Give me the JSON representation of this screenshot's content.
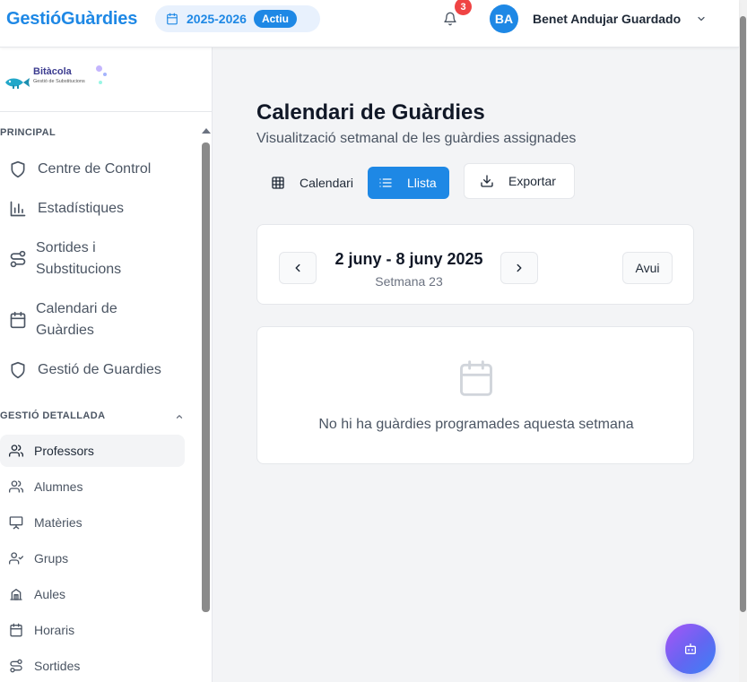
{
  "header": {
    "brand": "GestióGuàrdies",
    "year_label": "2025-2026",
    "year_badge": "Actiu",
    "notifications_count": "3",
    "user_initials": "BA",
    "user_name": "Benet Andujar Guardado"
  },
  "sidebar": {
    "logo_title": "Bitàcola",
    "logo_subtitle": "Gestió de Substitucions",
    "section_principal": "PRINCIPAL",
    "principal_items": [
      {
        "label_line1": "Centre de Control",
        "label_line2": "",
        "icon": "shield-icon"
      },
      {
        "label_line1": "Estadístiques",
        "label_line2": "",
        "icon": "bar-chart-icon"
      },
      {
        "label_line1": "Sortides i",
        "label_line2": "Substitucions",
        "icon": "route-icon"
      },
      {
        "label_line1": "Calendari de",
        "label_line2": "Guàrdies",
        "icon": "calendar-icon"
      },
      {
        "label_line1": "Gestió de Guardies",
        "label_line2": "",
        "icon": "shield-icon"
      }
    ],
    "section_detallada": "GESTIÓ DETALLADA",
    "detail_items": [
      {
        "label": "Professors",
        "icon": "users-icon",
        "active": true
      },
      {
        "label": "Alumnes",
        "icon": "users-icon",
        "active": false
      },
      {
        "label": "Matèries",
        "icon": "presentation-icon",
        "active": false
      },
      {
        "label": "Grups",
        "icon": "user-check-icon",
        "active": false
      },
      {
        "label": "Aules",
        "icon": "building-icon",
        "active": false
      },
      {
        "label": "Horaris",
        "icon": "calendar-icon",
        "active": false
      },
      {
        "label": "Sortides",
        "icon": "route-icon",
        "active": false
      }
    ]
  },
  "main": {
    "title": "Calendari de Guàrdies",
    "subtitle": "Visualització setmanal de les guàrdies assignades",
    "view_calendar_label": "Calendari",
    "view_list_label": "Llista",
    "active_view": "Llista",
    "export_label": "Exportar",
    "week_range": "2 juny - 8 juny 2025",
    "week_number": "Setmana 23",
    "today_label": "Avui",
    "empty_message": "No hi ha guàrdies programades aquesta setmana"
  },
  "colors": {
    "accent": "#1e88e5",
    "badge_red": "#ef4444",
    "fab_gradient": [
      "#a855f7",
      "#6366f1",
      "#3b82f6"
    ]
  }
}
